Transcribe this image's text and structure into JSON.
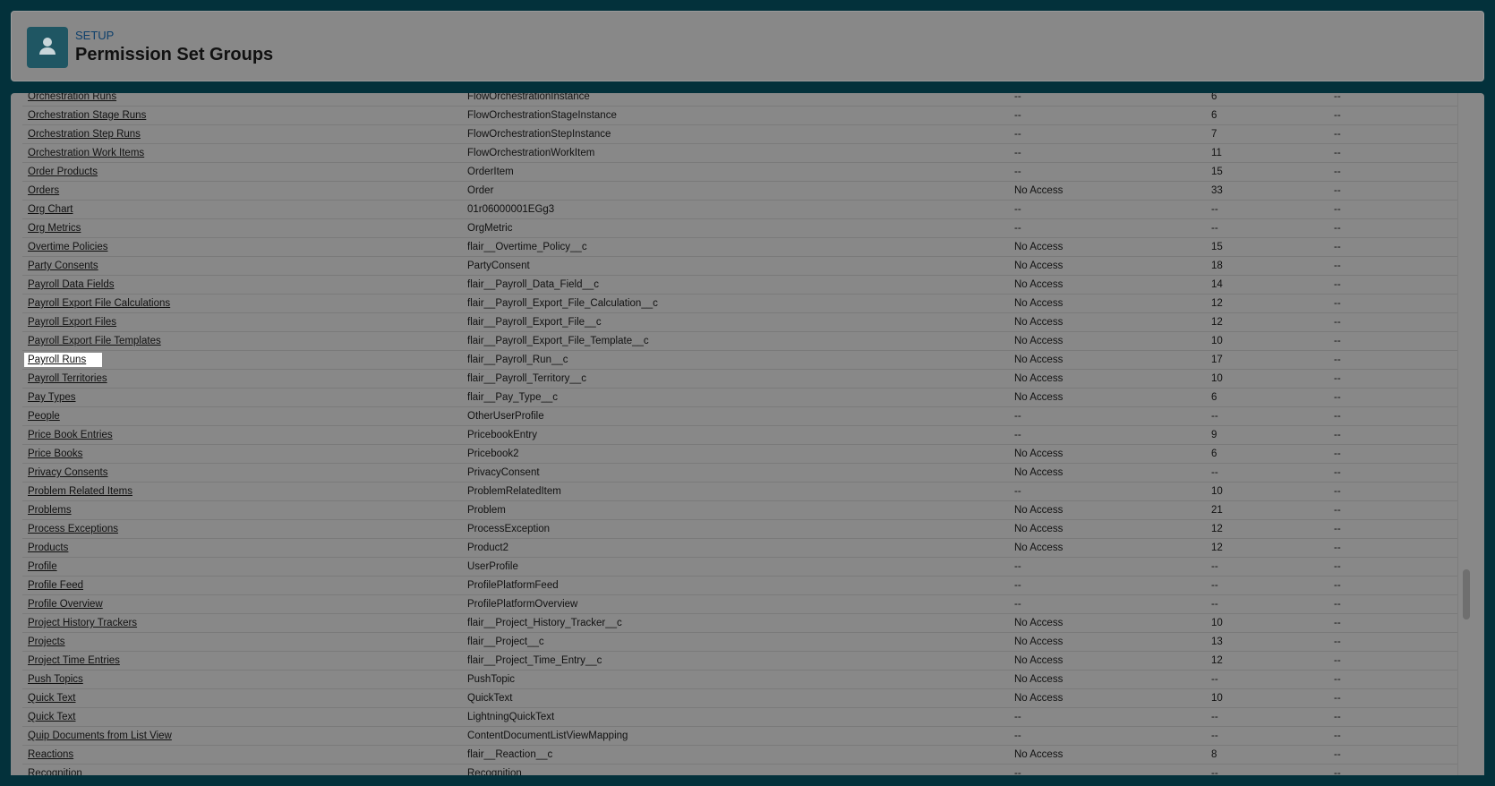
{
  "header": {
    "eyebrow": "SETUP",
    "title": "Permission Set Groups",
    "icon": "user-icon"
  },
  "rows": [
    [
      "Orchestration Runs",
      "FlowOrchestrationInstance",
      "--",
      "6",
      "--"
    ],
    [
      "Orchestration Stage Runs",
      "FlowOrchestrationStageInstance",
      "--",
      "6",
      "--"
    ],
    [
      "Orchestration Step Runs",
      "FlowOrchestrationStepInstance",
      "--",
      "7",
      "--"
    ],
    [
      "Orchestration Work Items",
      "FlowOrchestrationWorkItem",
      "--",
      "11",
      "--"
    ],
    [
      "Order Products",
      "OrderItem",
      "--",
      "15",
      "--"
    ],
    [
      "Orders",
      "Order",
      "No Access",
      "33",
      "--"
    ],
    [
      "Org Chart",
      "01r06000001EGg3",
      "--",
      "--",
      "--"
    ],
    [
      "Org Metrics",
      "OrgMetric",
      "--",
      "--",
      "--"
    ],
    [
      "Overtime Policies",
      "flair__Overtime_Policy__c",
      "No Access",
      "15",
      "--"
    ],
    [
      "Party Consents",
      "PartyConsent",
      "No Access",
      "18",
      "--"
    ],
    [
      "Payroll Data Fields",
      "flair__Payroll_Data_Field__c",
      "No Access",
      "14",
      "--"
    ],
    [
      "Payroll Export File Calculations",
      "flair__Payroll_Export_File_Calculation__c",
      "No Access",
      "12",
      "--"
    ],
    [
      "Payroll Export Files",
      "flair__Payroll_Export_File__c",
      "No Access",
      "12",
      "--"
    ],
    [
      "Payroll Export File Templates",
      "flair__Payroll_Export_File_Template__c",
      "No Access",
      "10",
      "--"
    ],
    [
      "Payroll Runs",
      "flair__Payroll_Run__c",
      "No Access",
      "17",
      "--"
    ],
    [
      "Payroll Territories",
      "flair__Payroll_Territory__c",
      "No Access",
      "10",
      "--"
    ],
    [
      "Pay Types",
      "flair__Pay_Type__c",
      "No Access",
      "6",
      "--"
    ],
    [
      "People",
      "OtherUserProfile",
      "--",
      "--",
      "--"
    ],
    [
      "Price Book Entries",
      "PricebookEntry",
      "--",
      "9",
      "--"
    ],
    [
      "Price Books",
      "Pricebook2",
      "No Access",
      "6",
      "--"
    ],
    [
      "Privacy Consents",
      "PrivacyConsent",
      "No Access",
      "--",
      "--"
    ],
    [
      "Problem Related Items",
      "ProblemRelatedItem",
      "--",
      "10",
      "--"
    ],
    [
      "Problems",
      "Problem",
      "No Access",
      "21",
      "--"
    ],
    [
      "Process Exceptions",
      "ProcessException",
      "No Access",
      "12",
      "--"
    ],
    [
      "Products",
      "Product2",
      "No Access",
      "12",
      "--"
    ],
    [
      "Profile",
      "UserProfile",
      "--",
      "--",
      "--"
    ],
    [
      "Profile Feed",
      "ProfilePlatformFeed",
      "--",
      "--",
      "--"
    ],
    [
      "Profile Overview",
      "ProfilePlatformOverview",
      "--",
      "--",
      "--"
    ],
    [
      "Project History Trackers",
      "flair__Project_History_Tracker__c",
      "No Access",
      "10",
      "--"
    ],
    [
      "Projects",
      "flair__Project__c",
      "No Access",
      "13",
      "--"
    ],
    [
      "Project Time Entries",
      "flair__Project_Time_Entry__c",
      "No Access",
      "12",
      "--"
    ],
    [
      "Push Topics",
      "PushTopic",
      "No Access",
      "--",
      "--"
    ],
    [
      "Quick Text",
      "QuickText",
      "No Access",
      "10",
      "--"
    ],
    [
      "Quick Text",
      "LightningQuickText",
      "--",
      "--",
      "--"
    ],
    [
      "Quip Documents from List View",
      "ContentDocumentListViewMapping",
      "--",
      "--",
      "--"
    ],
    [
      "Reactions",
      "flair__Reaction__c",
      "No Access",
      "8",
      "--"
    ],
    [
      "Recognition",
      "Recognition",
      "--",
      "--",
      "--"
    ]
  ],
  "highlighted_row": "Payroll Runs"
}
